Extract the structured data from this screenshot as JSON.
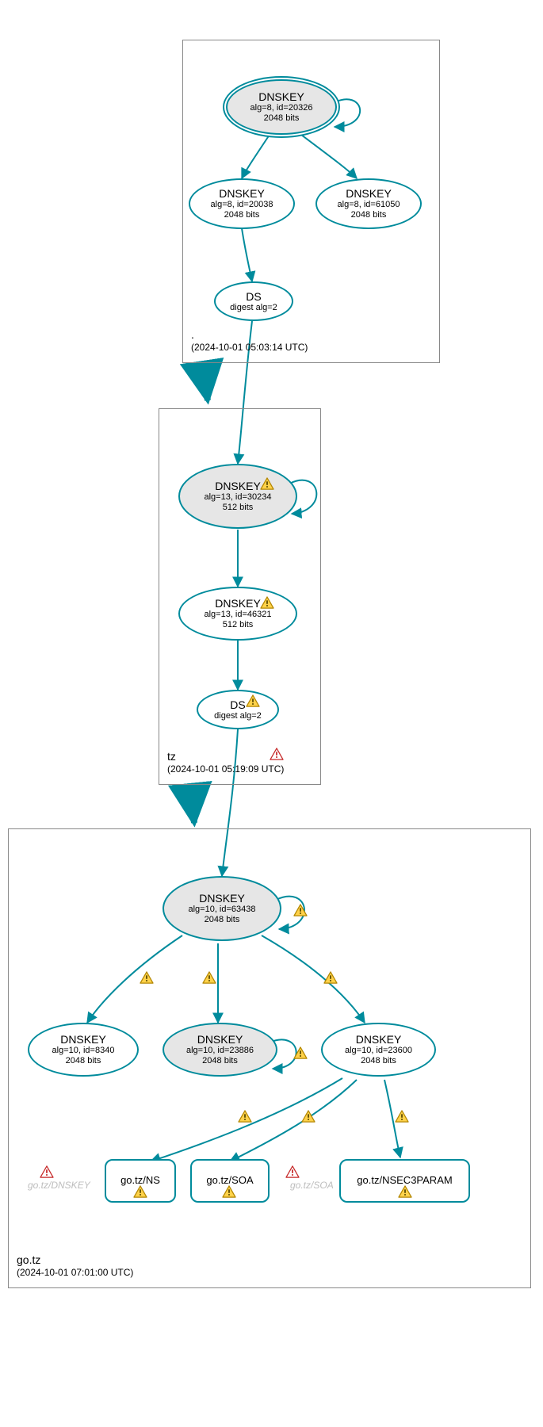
{
  "zones": {
    "root": {
      "name": ".",
      "timestamp": "(2024-10-01 05:03:14 UTC)"
    },
    "tz": {
      "name": "tz",
      "timestamp": "(2024-10-01 05:19:09 UTC)"
    },
    "gotz": {
      "name": "go.tz",
      "timestamp": "(2024-10-01 07:01:00 UTC)"
    }
  },
  "nodes": {
    "root_ksk": {
      "title": "DNSKEY",
      "line1": "alg=8, id=20326",
      "line2": "2048 bits"
    },
    "root_zsk1": {
      "title": "DNSKEY",
      "line1": "alg=8, id=20038",
      "line2": "2048 bits"
    },
    "root_zsk2": {
      "title": "DNSKEY",
      "line1": "alg=8, id=61050",
      "line2": "2048 bits"
    },
    "root_ds": {
      "title": "DS",
      "line1": "digest alg=2"
    },
    "tz_ksk": {
      "title": "DNSKEY",
      "line1": "alg=13, id=30234",
      "line2": "512 bits"
    },
    "tz_zsk": {
      "title": "DNSKEY",
      "line1": "alg=13, id=46321",
      "line2": "512 bits"
    },
    "tz_ds": {
      "title": "DS",
      "line1": "digest alg=2"
    },
    "gotz_ksk": {
      "title": "DNSKEY",
      "line1": "alg=10, id=63438",
      "line2": "2048 bits"
    },
    "gotz_k1": {
      "title": "DNSKEY",
      "line1": "alg=10, id=8340",
      "line2": "2048 bits"
    },
    "gotz_k2": {
      "title": "DNSKEY",
      "line1": "alg=10, id=23886",
      "line2": "2048 bits"
    },
    "gotz_k3": {
      "title": "DNSKEY",
      "line1": "alg=10, id=23600",
      "line2": "2048 bits"
    },
    "rr_ns": {
      "title": "go.tz/NS"
    },
    "rr_soa": {
      "title": "go.tz/SOA"
    },
    "rr_nsec3": {
      "title": "go.tz/NSEC3PARAM"
    }
  },
  "ghosts": {
    "dnskey": "go.tz/DNSKEY",
    "soa": "go.tz/SOA"
  }
}
